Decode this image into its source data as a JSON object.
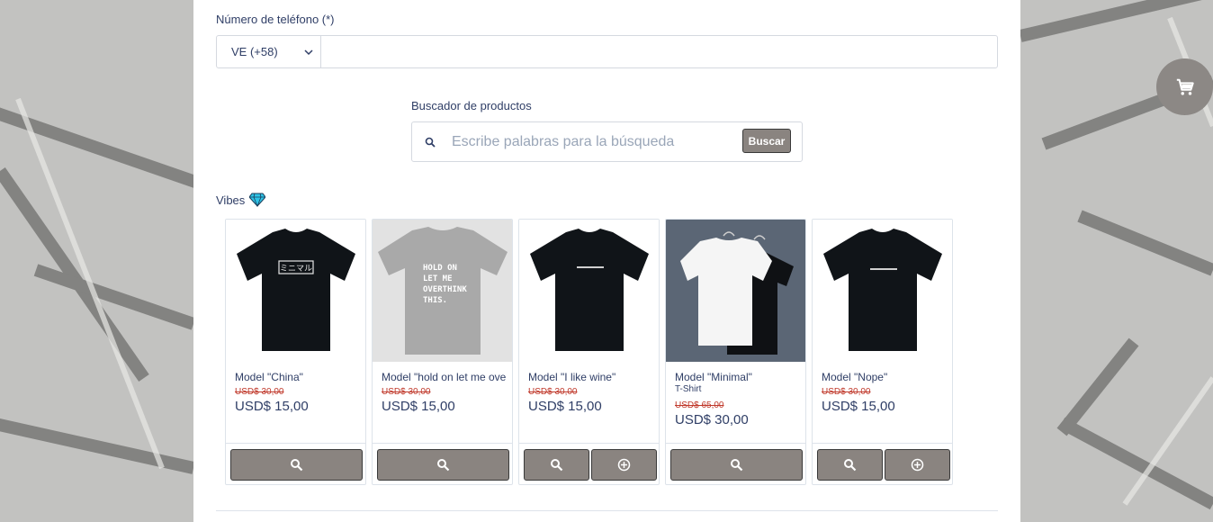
{
  "form": {
    "phone_label": "Número de teléfono (*)",
    "country_code": "VE (+58)",
    "phone_value": ""
  },
  "search": {
    "label": "Buscador de productos",
    "placeholder": "Escribe palabras para la búsqueda",
    "button_label": "Buscar"
  },
  "section": {
    "title": "Vibes",
    "icon": "gem-icon"
  },
  "products": [
    {
      "name": "Model \"China\"",
      "old_price": "USD$ 30,00",
      "price": "USD$ 15,00",
      "actions": [
        "view-icon"
      ]
    },
    {
      "name": "Model \"hold on let me ove",
      "old_price": "USD$ 30,00",
      "price": "USD$ 15,00",
      "actions": [
        "view-icon"
      ],
      "print_text": "HOLD ON LET ME OVERTHINK THIS."
    },
    {
      "name": "Model \"I like wine\"",
      "old_price": "USD$ 30,00",
      "price": "USD$ 15,00",
      "actions": [
        "view-icon",
        "add-icon"
      ]
    },
    {
      "name": "Model \"Minimal\"",
      "type": "T-Shirt",
      "old_price": "USD$ 65,00",
      "price": "USD$ 30,00",
      "actions": [
        "view-icon"
      ]
    },
    {
      "name": "Model \"Nope\"",
      "old_price": "USD$ 30,00",
      "price": "USD$ 15,00",
      "actions": [
        "view-icon",
        "add-icon"
      ]
    }
  ],
  "cart": {
    "icon": "cart-icon"
  },
  "colors": {
    "accent_button": "#8a8480",
    "text": "#2f3e66",
    "strike_price": "#c0392b"
  }
}
